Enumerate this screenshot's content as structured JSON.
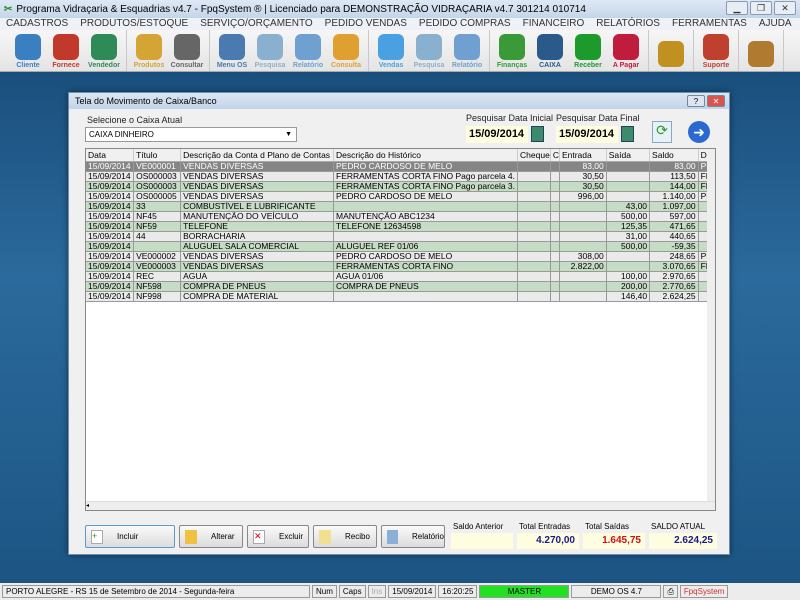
{
  "window": {
    "title": "Programa Vidraçaria & Esquadrias v4.7 - FpqSystem ® | Licenciado para  DEMONSTRAÇÃO VIDRAÇARIA v4.7 301214 010714"
  },
  "menu": [
    "CADASTROS",
    "PRODUTOS/ESTOQUE",
    "SERVIÇO/ORÇAMENTO",
    "PEDIDO VENDAS",
    "PEDIDO COMPRAS",
    "FINANCEIRO",
    "RELATÓRIOS",
    "FERRAMENTAS",
    "AJUDA"
  ],
  "toolbar": [
    [
      {
        "label": "Cliente",
        "color": "#3a7fc0",
        "icon": "user-icon"
      },
      {
        "label": "Fornece",
        "color": "#c0392b",
        "icon": "supplier-icon"
      },
      {
        "label": "Vendedor",
        "color": "#2e8b57",
        "icon": "seller-icon"
      }
    ],
    [
      {
        "label": "Produtos",
        "color": "#d4a437",
        "icon": "boxes-icon"
      },
      {
        "label": "Consultar",
        "color": "#666666",
        "icon": "barcode-icon"
      }
    ],
    [
      {
        "label": "Menu OS",
        "color": "#4a7ab0",
        "icon": "clipboard-icon"
      },
      {
        "label": "Pesquisa",
        "color": "#8ab0d0",
        "icon": "search-doc-icon"
      },
      {
        "label": "Relatório",
        "color": "#70a0d0",
        "icon": "printer-icon"
      },
      {
        "label": "Consulta",
        "color": "#e0a030",
        "icon": "folder-icon"
      }
    ],
    [
      {
        "label": "Vendas",
        "color": "#4aa0e0",
        "icon": "monitor-icon"
      },
      {
        "label": "Pesquisa",
        "color": "#8ab0d0",
        "icon": "search-doc-icon"
      },
      {
        "label": "Relatório",
        "color": "#70a0d0",
        "icon": "printer-icon"
      }
    ],
    [
      {
        "label": "Finanças",
        "color": "#3a9a3a",
        "icon": "finance-chart-icon"
      },
      {
        "label": "CAIXA",
        "color": "#2a5a8a",
        "icon": "cashbook-icon"
      },
      {
        "label": "Receber",
        "color": "#1c9a2c",
        "icon": "dollar-green-icon"
      },
      {
        "label": "A Pagar",
        "color": "#c01c3c",
        "icon": "dollar-red-icon"
      }
    ],
    [
      {
        "label": "",
        "color": "#c09020",
        "icon": "coins-icon"
      }
    ],
    [
      {
        "label": "Suporte",
        "color": "#c04030",
        "icon": "support-icon"
      }
    ],
    [
      {
        "label": "",
        "color": "#b07a30",
        "icon": "exit-door-icon"
      }
    ]
  ],
  "dialog": {
    "title": "Tela do Movimento de Caixa/Banco",
    "caixa_label": "Selecione o Caixa Atual",
    "caixa_value": "CAIXA DINHEIRO",
    "data_ini_label": "Pesquisar Data Inicial",
    "data_ini": "15/09/2014",
    "data_fim_label": "Pesquisar Data Final",
    "data_fim": "15/09/2014"
  },
  "grid": {
    "columns": [
      "Data",
      "Título",
      "Descrição da Conta d Plano de Contas",
      "Descrição do Histórico",
      "Cheque",
      "C",
      "Entrada",
      "Saída",
      "Saldo",
      "D"
    ],
    "rows": [
      [
        "15/09/2014",
        "VE000001",
        "VENDAS DIVERSAS",
        "PEDRO CARDOSO DE MELO",
        "",
        "",
        "83,00",
        "",
        "83,00",
        "PE"
      ],
      [
        "15/09/2014",
        "OS000003",
        "VENDAS DIVERSAS",
        "FERRAMENTAS CORTA FINO Pago parcela 4.",
        "",
        "",
        "30,50",
        "",
        "113,50",
        "FE"
      ],
      [
        "15/09/2014",
        "OS000003",
        "VENDAS DIVERSAS",
        "FERRAMENTAS CORTA FINO Pago parcela 3.",
        "",
        "",
        "30,50",
        "",
        "144,00",
        "FE"
      ],
      [
        "15/09/2014",
        "OS000005",
        "VENDAS DIVERSAS",
        "PEDRO CARDOSO DE MELO",
        "",
        "",
        "996,00",
        "",
        "1.140,00",
        "PE"
      ],
      [
        "15/09/2014",
        "33",
        "COMBUSTÍVEL E LUBRIFICANTE",
        "",
        "",
        "",
        "",
        "43,00",
        "1.097,00",
        ""
      ],
      [
        "15/09/2014",
        "NF45",
        "MANUTENÇÃO DO VEÍCULO",
        "MANUTENÇÃO ABC1234",
        "",
        "",
        "",
        "500,00",
        "597,00",
        ""
      ],
      [
        "15/09/2014",
        "NF59",
        "TELEFONE",
        "TELEFONE 12634598",
        "",
        "",
        "",
        "125,35",
        "471,65",
        ""
      ],
      [
        "15/09/2014",
        "44",
        "BORRACHARIA",
        "",
        "",
        "",
        "",
        "31,00",
        "440,65",
        ""
      ],
      [
        "15/09/2014",
        "",
        "ALUGUEL SALA COMERCIAL",
        "ALUGUEL REF 01/06",
        "",
        "",
        "",
        "500,00",
        "-59,35",
        ""
      ],
      [
        "15/09/2014",
        "VE000002",
        "VENDAS DIVERSAS",
        "PEDRO CARDOSO DE MELO",
        "",
        "",
        "308,00",
        "",
        "248,65",
        "PE"
      ],
      [
        "15/09/2014",
        "VE000003",
        "VENDAS DIVERSAS",
        "FERRAMENTAS CORTA FINO",
        "",
        "",
        "2.822,00",
        "",
        "3.070,65",
        "FE"
      ],
      [
        "15/09/2014",
        "REC",
        "AGUA",
        "AGUA 01/06",
        "",
        "",
        "",
        "100,00",
        "2.970,65",
        ""
      ],
      [
        "15/09/2014",
        "NF598",
        "COMPRA DE PNEUS",
        "COMPRA DE PNEUS",
        "",
        "",
        "",
        "200,00",
        "2.770,65",
        ""
      ],
      [
        "15/09/2014",
        "NF998",
        "COMPRA DE MATERIAL",
        "",
        "",
        "",
        "",
        "146,40",
        "2.624,25",
        ""
      ]
    ]
  },
  "buttons": {
    "incluir": "Incluir",
    "alterar": "Alterar",
    "excluir": "Excluir",
    "recibo": "Recibo",
    "relatorio": "Relatório"
  },
  "totals": {
    "saldo_anterior_label": "Saldo Anterior",
    "saldo_anterior": "",
    "entradas_label": "Total Entradas",
    "entradas": "4.270,00",
    "saidas_label": "Total Saídas",
    "saidas": "1.645,75",
    "saldo_atual_label": "SALDO ATUAL",
    "saldo_atual": "2.624,25"
  },
  "status": {
    "location": "PORTO ALEGRE - RS 15 de Setembro de 2014 - Segunda-feira",
    "num": "Num",
    "caps": "Caps",
    "ins": "Ins",
    "date": "15/09/2014",
    "time": "16:20:25",
    "user": "MASTER",
    "version": "DEMO OS 4.7",
    "brand": "FpqSystem"
  }
}
